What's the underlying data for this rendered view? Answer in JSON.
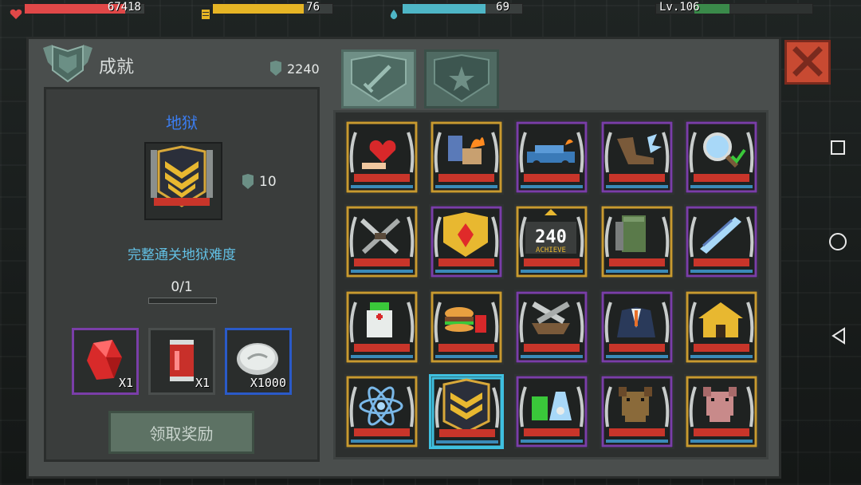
{
  "hud": {
    "health": {
      "value": "67418",
      "fill": 0.84,
      "color": "#e04848"
    },
    "energy": {
      "value": "76",
      "fill": 0.76,
      "color": "#e6b525"
    },
    "water": {
      "value": "69",
      "fill": 0.69,
      "color": "#4eb6c6"
    },
    "level": {
      "label": "Lv.106",
      "fill": 0.3,
      "color": "#3a8a4a"
    }
  },
  "panel": {
    "title": "成就",
    "points": "2240"
  },
  "detail": {
    "name": "地狱",
    "points": "10",
    "description": "完整通关地狱难度",
    "progress": "0/1",
    "progress_fill": 0.0,
    "rewards": [
      {
        "name": "red-crystal",
        "count": "X1",
        "border": "#7a3ea8"
      },
      {
        "name": "red-soda-can",
        "count": "X1",
        "border": "#4a4e4d"
      },
      {
        "name": "silver-coin",
        "count": "X1000",
        "border": "#2a5ac8"
      }
    ],
    "claim_label": "领取奖励"
  },
  "tabs": [
    {
      "name": "tab-shield-sword",
      "active": true
    },
    {
      "name": "tab-shield-star",
      "active": false
    }
  ],
  "achievements": [
    {
      "icon": "heart-hand",
      "frame": "#c89a30"
    },
    {
      "icon": "barrel-fire",
      "frame": "#c89a30"
    },
    {
      "icon": "burning-car",
      "frame": "#7a3ea8"
    },
    {
      "icon": "kick-boot",
      "frame": "#7a3ea8"
    },
    {
      "icon": "magnifier-check",
      "frame": "#7a3ea8"
    },
    {
      "icon": "crossed-knives",
      "frame": "#c89a30"
    },
    {
      "icon": "red-gem-crest",
      "frame": "#7a3ea8"
    },
    {
      "icon": "achieve-240",
      "frame": "#c89a30",
      "text": "240",
      "subtext": "ACHIEVE"
    },
    {
      "icon": "green-locker",
      "frame": "#c89a30"
    },
    {
      "icon": "blades",
      "frame": "#7a3ea8"
    },
    {
      "icon": "medicine-bottle",
      "frame": "#c89a30"
    },
    {
      "icon": "burger-drink",
      "frame": "#c89a30"
    },
    {
      "icon": "anvil-hammers",
      "frame": "#7a3ea8"
    },
    {
      "icon": "suit",
      "frame": "#7a3ea8"
    },
    {
      "icon": "golden-house",
      "frame": "#c89a30"
    },
    {
      "icon": "atom",
      "frame": "#c89a30"
    },
    {
      "icon": "gold-chevron-crest",
      "frame": "#3fc0e0",
      "selected": true
    },
    {
      "icon": "potion-bottles",
      "frame": "#7a3ea8"
    },
    {
      "icon": "brown-dog",
      "frame": "#7a3ea8"
    },
    {
      "icon": "pink-dog",
      "frame": "#c89a30"
    }
  ]
}
